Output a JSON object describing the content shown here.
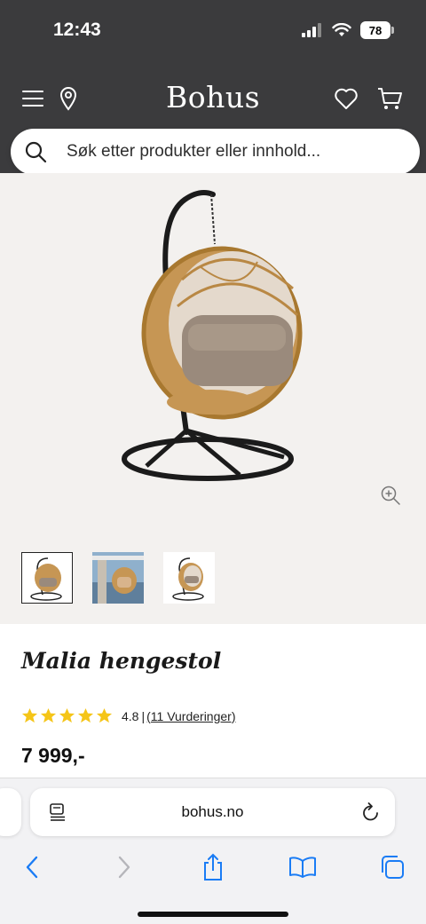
{
  "status_bar": {
    "time": "12:43",
    "battery": "78"
  },
  "header": {
    "brand": "Bohus",
    "icons": [
      "menu-icon",
      "location-pin-icon",
      "heart-icon",
      "cart-icon"
    ],
    "background": "#3b3b3d"
  },
  "search": {
    "placeholder": "Søk etter produkter eller innhold..."
  },
  "gallery": {
    "thumbnails": [
      "chair-front-thumbnail",
      "chair-lifestyle-thumbnail",
      "chair-detail-thumbnail"
    ],
    "selected_thumbnail": 1
  },
  "product": {
    "title": "Malia hengestol",
    "rating": "4.8",
    "rating_separator": "|",
    "reviews": "(11 Vurderinger)",
    "stars": 5,
    "star_color": "#f5c518",
    "price": "7 999,-"
  },
  "browser": {
    "url": "bohus.no",
    "toolbar": [
      "back-icon",
      "forward-icon",
      "share-icon",
      "bookmarks-icon",
      "tabs-icon"
    ],
    "accent": "#1a7cf5"
  }
}
